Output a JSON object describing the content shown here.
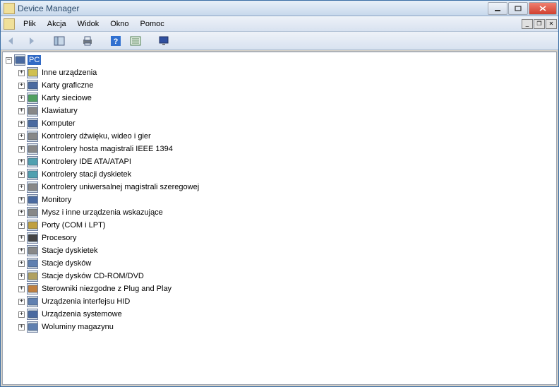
{
  "window": {
    "title": "Device Manager"
  },
  "menu": {
    "items": [
      "Plik",
      "Akcja",
      "Widok",
      "Okno",
      "Pomoc"
    ]
  },
  "tree": {
    "root": {
      "label": "PC",
      "icon": "computer-icon",
      "expanded": true,
      "selected": true
    },
    "children": [
      {
        "label": "Inne urządzenia",
        "icon": "unknown-icon"
      },
      {
        "label": "Karty graficzne",
        "icon": "display-icon"
      },
      {
        "label": "Karty sieciowe",
        "icon": "network-icon"
      },
      {
        "label": "Klawiatury",
        "icon": "keyboard-icon"
      },
      {
        "label": "Komputer",
        "icon": "computer-icon"
      },
      {
        "label": "Kontrolery dźwięku, wideo i gier",
        "icon": "sound-icon"
      },
      {
        "label": "Kontrolery hosta magistrali IEEE 1394",
        "icon": "plug-icon"
      },
      {
        "label": "Kontrolery IDE ATA/ATAPI",
        "icon": "ide-icon"
      },
      {
        "label": "Kontrolery stacji dyskietek",
        "icon": "floppy-ctl-icon"
      },
      {
        "label": "Kontrolery uniwersalnej magistrali szeregowej",
        "icon": "usb-icon"
      },
      {
        "label": "Monitory",
        "icon": "monitor-icon"
      },
      {
        "label": "Mysz i inne urządzenia wskazujące",
        "icon": "mouse-icon"
      },
      {
        "label": "Porty (COM i LPT)",
        "icon": "port-icon"
      },
      {
        "label": "Procesory",
        "icon": "cpu-icon"
      },
      {
        "label": "Stacje dyskietek",
        "icon": "floppy-icon"
      },
      {
        "label": "Stacje dysków",
        "icon": "disk-icon"
      },
      {
        "label": "Stacje dysków CD-ROM/DVD",
        "icon": "cdrom-icon"
      },
      {
        "label": "Sterowniki niezgodne z Plug and Play",
        "icon": "nopnp-icon"
      },
      {
        "label": "Urządzenia interfejsu HID",
        "icon": "hid-icon"
      },
      {
        "label": "Urządzenia systemowe",
        "icon": "system-icon"
      },
      {
        "label": "Woluminy magazynu",
        "icon": "volume-icon"
      }
    ]
  },
  "colors": {
    "selection": "#316ac5"
  }
}
